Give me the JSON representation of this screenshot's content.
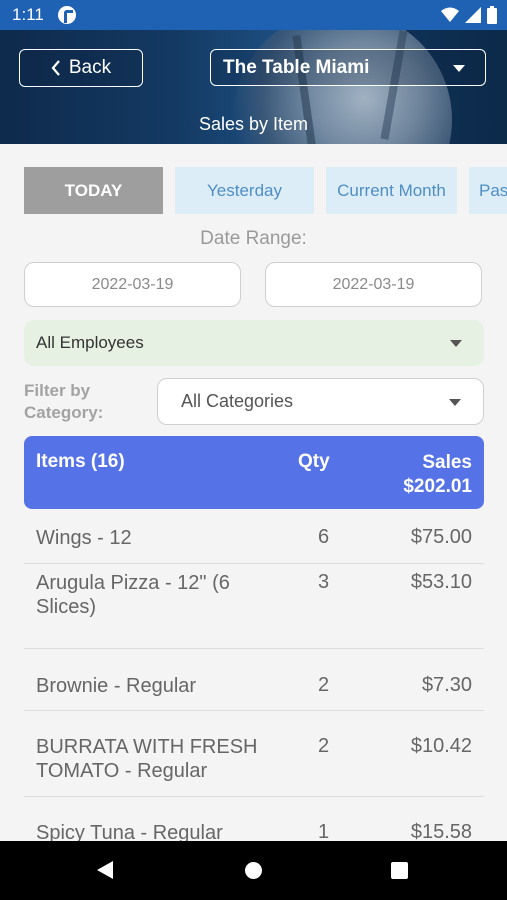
{
  "status_bar": {
    "time": "1:11"
  },
  "header": {
    "back_label": "Back",
    "location": "The Table Miami",
    "title": "Sales by Item"
  },
  "quick_ranges": [
    "TODAY",
    "Yesterday",
    "Current Month",
    "Pas"
  ],
  "date_range": {
    "label": "Date Range:",
    "start": "2022-03-19",
    "end": "2022-03-19"
  },
  "employee_filter": {
    "value": "All Employees"
  },
  "category_filter": {
    "label": "Filter by Category:",
    "value": "All Categories"
  },
  "table": {
    "header": {
      "items": "Items (16)",
      "qty": "Qty",
      "sales": "Sales",
      "total": "$202.01"
    },
    "rows": [
      {
        "name": "Wings - 12",
        "qty": "6",
        "amount": "$75.00"
      },
      {
        "name": "Arugula Pizza - 12\" (6 Slices)",
        "qty": "3",
        "amount": "$53.10"
      },
      {
        "name": "Brownie - Regular",
        "qty": "2",
        "amount": "$7.30"
      },
      {
        "name": "BURRATA WITH FRESH TOMATO - Regular",
        "qty": "2",
        "amount": "$10.42"
      },
      {
        "name": "Spicy Tuna - Regular",
        "qty": "1",
        "amount": "$15.58"
      }
    ]
  }
}
